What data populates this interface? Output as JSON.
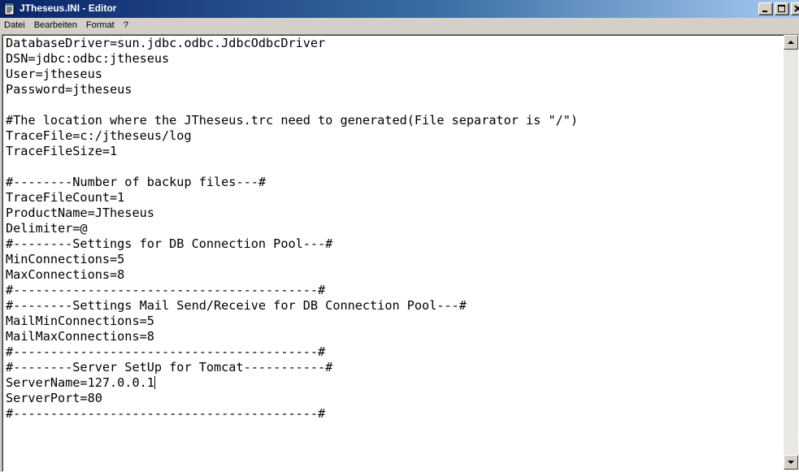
{
  "window": {
    "title": "JTheseus.INI - Editor"
  },
  "menu": [
    {
      "label": "Datei"
    },
    {
      "label": "Bearbeiten"
    },
    {
      "label": "Format"
    },
    {
      "label": "?"
    }
  ],
  "editor": {
    "lines": [
      "DatabaseDriver=sun.jdbc.odbc.JdbcOdbcDriver",
      "DSN=jdbc:odbc:jtheseus",
      "User=jtheseus",
      "Password=jtheseus",
      "",
      "#The location where the JTheseus.trc need to generated(File separator is \"/\")",
      "TraceFile=c:/jtheseus/log",
      "TraceFileSize=1",
      "",
      "#--------Number of backup files---#",
      "TraceFileCount=1",
      "ProductName=JTheseus",
      "Delimiter=@",
      "#--------Settings for DB Connection Pool---#",
      "MinConnections=5",
      "MaxConnections=8",
      "#-----------------------------------------#",
      "#--------Settings Mail Send/Receive for DB Connection Pool---#",
      "MailMinConnections=5",
      "MailMaxConnections=8",
      "#-----------------------------------------#",
      "#--------Server SetUp for Tomcat-----------#",
      "ServerName=127.0.0.1",
      "ServerPort=80",
      "#-----------------------------------------#"
    ],
    "caret_line": 22
  },
  "icons": {
    "app": "notepad-icon",
    "minimize": "minimize-icon",
    "maximize": "maximize-icon",
    "close": "close-icon",
    "scroll_up": "arrow-up-icon",
    "scroll_down": "arrow-down-icon"
  }
}
